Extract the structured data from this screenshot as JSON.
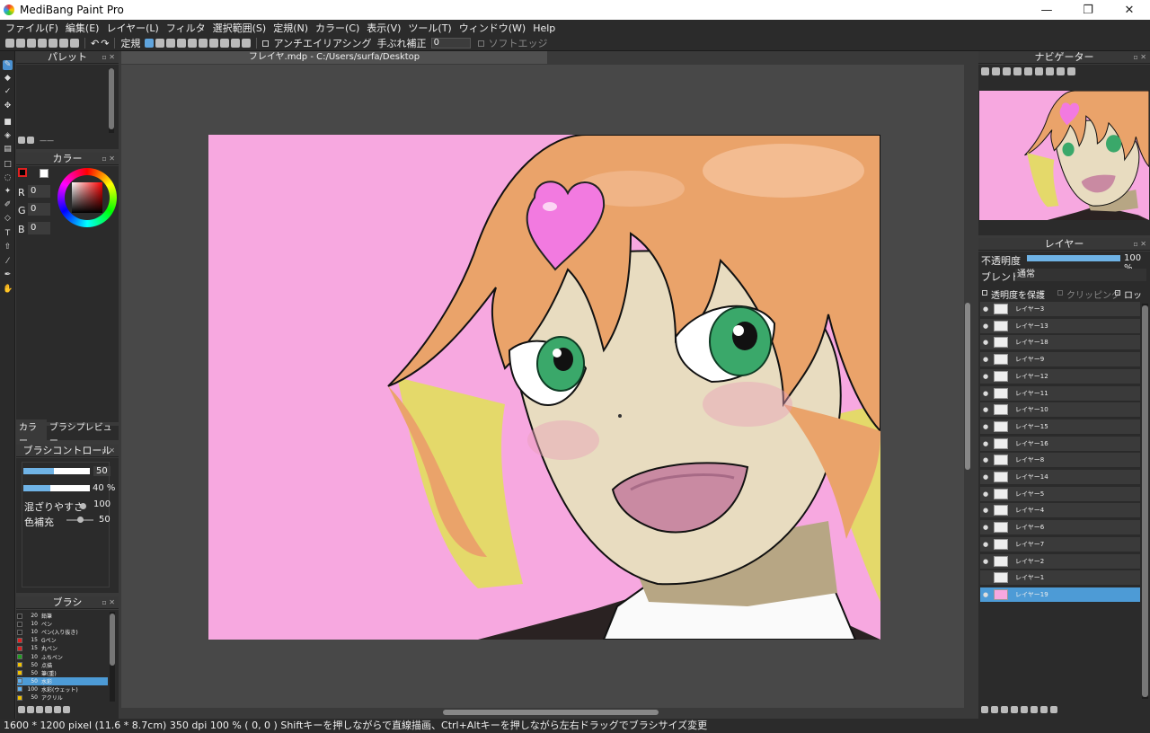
{
  "app": {
    "title": "MediBang Paint Pro",
    "minimize": "—",
    "maximize": "❐",
    "close": "✕"
  },
  "menu": [
    "ファイル(F)",
    "編集(E)",
    "レイヤー(L)",
    "フィルタ",
    "選択範囲(S)",
    "定規(N)",
    "カラー(C)",
    "表示(V)",
    "ツール(T)",
    "ウィンドウ(W)",
    "Help"
  ],
  "toolbar": {
    "ruler_label": "定規",
    "antialias_label": "アンチエイリアシング",
    "stabilizer_label": "手ぶれ補正",
    "stabilizer_value": "0",
    "soft_edge_label": "ソフトエッジ"
  },
  "document": {
    "tab_title": "フレイヤ.mdp - C:/Users/surfa/Desktop"
  },
  "palette": {
    "title": "パレット",
    "footer": "——"
  },
  "color": {
    "title": "カラー",
    "r_label": "R",
    "r_value": "0",
    "g_label": "G",
    "g_value": "0",
    "b_label": "B",
    "b_value": "0",
    "primary": "#000000",
    "secondary": "#ffffff"
  },
  "tabs": {
    "color_tab": "カラー",
    "brush_preview_tab": "ブラシプレビュー"
  },
  "brush_control": {
    "title": "ブラシコントロール",
    "size_value": "50",
    "opacity_value": "40 %",
    "blend_label": "混ざりやすさ",
    "blend_value": "100",
    "color_fill_label": "色補充",
    "color_fill_value": "50",
    "size_fraction": 0.46,
    "opacity_fraction": 0.4
  },
  "brush": {
    "title": "ブラシ",
    "items": [
      {
        "size": "20",
        "name": "鉛筆",
        "color": "#222222"
      },
      {
        "size": "10",
        "name": "ペン",
        "color": "#222222"
      },
      {
        "size": "10",
        "name": "ペン(入り抜き)",
        "color": "#222222"
      },
      {
        "size": "15",
        "name": "Gペン",
        "color": "#e02020"
      },
      {
        "size": "15",
        "name": "丸ペン",
        "color": "#e02020"
      },
      {
        "size": "10",
        "name": "ふちペン",
        "color": "#20a020"
      },
      {
        "size": "50",
        "name": "点描",
        "color": "#f0c000"
      },
      {
        "size": "50",
        "name": "筆(重)",
        "color": "#f0c000"
      },
      {
        "size": "50",
        "name": "水彩",
        "color": "#5fb0f0"
      },
      {
        "size": "100",
        "name": "水彩(ウェット)",
        "color": "#5fb0f0"
      },
      {
        "size": "50",
        "name": "アクリル",
        "color": "#f0c000"
      }
    ],
    "selected_index": 8
  },
  "navigator": {
    "title": "ナビゲーター"
  },
  "layers": {
    "title": "レイヤー",
    "opacity_label": "不透明度",
    "opacity_value": "100 %",
    "blend_label": "ブレンド",
    "blend_value": "通常",
    "protect_alpha": "透明度を保護",
    "clipping": "クリッピング",
    "lock": "ロック",
    "items": [
      "レイヤー3",
      "レイヤー13",
      "レイヤー18",
      "レイヤー9",
      "レイヤー12",
      "レイヤー11",
      "レイヤー10",
      "レイヤー15",
      "レイヤー16",
      "レイヤー8",
      "レイヤー14",
      "レイヤー5",
      "レイヤー4",
      "レイヤー6",
      "レイヤー7",
      "レイヤー2",
      "レイヤー1",
      "レイヤー19"
    ],
    "selected_index": 17
  },
  "status": {
    "text": "1600 * 1200 pixel   (11.6 * 8.7cm)   350 dpi   100 %   ( 0, 0 )   Shiftキーを押しながらで直線描画、Ctrl+Altキーを押しながら左右ドラッグでブラシサイズ変更"
  },
  "colors": {
    "accent": "#4d9bd6",
    "canvas_bg": "#f7a8e0",
    "hair": "#eaa36a",
    "skin": "#e8dcc0",
    "eye": "#3aa86a"
  }
}
